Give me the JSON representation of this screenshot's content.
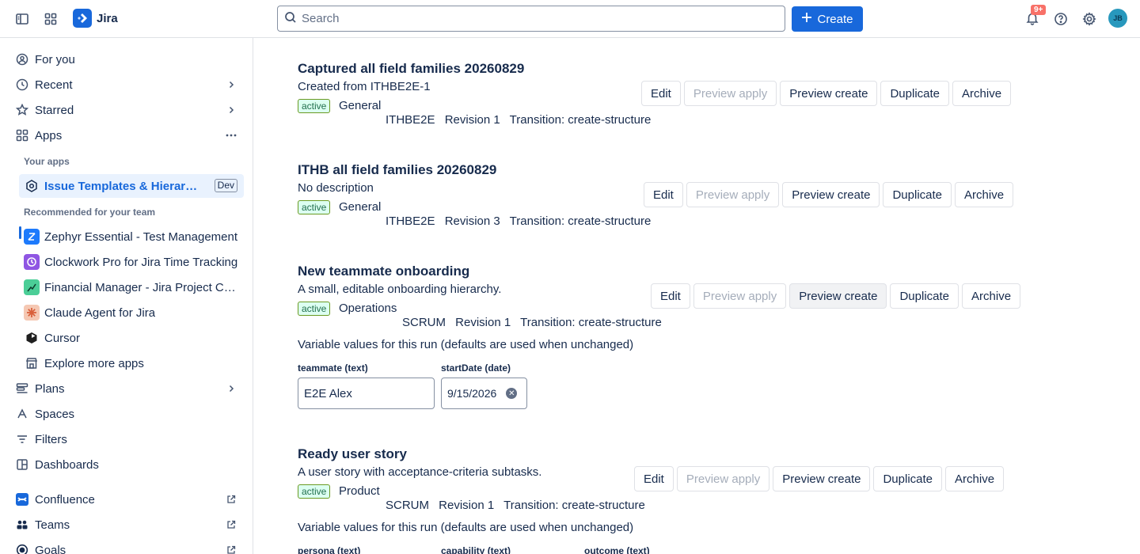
{
  "app": {
    "name": "Jira"
  },
  "topbar": {
    "search_placeholder": "Search",
    "create_label": "Create",
    "notification_count": "9+",
    "avatar_initials": "JB"
  },
  "sidebar": {
    "nav": [
      {
        "label": "For you",
        "icon": "person-circle-icon"
      },
      {
        "label": "Recent",
        "icon": "clock-icon"
      },
      {
        "label": "Starred",
        "icon": "star-icon"
      },
      {
        "label": "Apps",
        "icon": "apps-grid-icon"
      }
    ],
    "your_apps_heading": "Your apps",
    "selected_app": {
      "label": "Issue Templates & Hierarchies",
      "tag": "Dev"
    },
    "recommended_heading": "Recommended for your team",
    "recommended": [
      {
        "label": "Zephyr Essential - Test Management",
        "color": "#1d7afc"
      },
      {
        "label": "Clockwork Pro for Jira Time Tracking",
        "color": "#8f56e3"
      },
      {
        "label": "Financial Manager - Jira Project Cost",
        "color": "#4bce97"
      },
      {
        "label": "Claude Agent for Jira",
        "color": "#e8855e"
      },
      {
        "label": "Cursor",
        "color": "#1f1f1f"
      },
      {
        "label": "Explore more apps",
        "color": "#44546f"
      }
    ],
    "nav2": [
      {
        "label": "Plans",
        "icon": "plans-icon"
      },
      {
        "label": "Spaces",
        "icon": "spaces-icon"
      },
      {
        "label": "Filters",
        "icon": "filter-icon"
      },
      {
        "label": "Dashboards",
        "icon": "dashboard-icon"
      }
    ],
    "external": [
      {
        "label": "Confluence",
        "icon": "confluence-icon"
      },
      {
        "label": "Teams",
        "icon": "teams-icon"
      },
      {
        "label": "Goals",
        "icon": "goals-icon"
      }
    ]
  },
  "buttons": {
    "edit": "Edit",
    "preview_apply": "Preview apply",
    "preview_create": "Preview create",
    "duplicate": "Duplicate",
    "archive": "Archive"
  },
  "templates": [
    {
      "title": "Captured all field families 20260829",
      "description": "Created from ITHBE2E-1",
      "status": "active",
      "category": "General",
      "project": "ITHBE2E",
      "revision": "Revision 1",
      "transition": "Transition: create-structure"
    },
    {
      "title": "ITHB all field families 20260829",
      "description": "No description",
      "status": "active",
      "category": "General",
      "project": "ITHBE2E",
      "revision": "Revision 3",
      "transition": "Transition: create-structure"
    },
    {
      "title": "New teammate onboarding",
      "description": "A small, editable onboarding hierarchy.",
      "status": "active",
      "category": "Operations",
      "project": "SCRUM",
      "revision": "Revision 1",
      "transition": "Transition: create-structure",
      "variables_title": "Variable values for this run (defaults are used when unchanged)",
      "variables": [
        {
          "label": "teammate (text)",
          "value": "E2E Alex"
        },
        {
          "label": "startDate (date)",
          "value": "9/15/2026"
        }
      ]
    },
    {
      "title": "Ready user story",
      "description": "A user story with acceptance-criteria subtasks.",
      "status": "active",
      "category": "Product",
      "project": "SCRUM",
      "revision": "Revision 1",
      "transition": "Transition: create-structure",
      "variables_title": "Variable values for this run (defaults are used when unchanged)",
      "variables": [
        {
          "label": "persona (text)"
        },
        {
          "label": "capability (text)"
        },
        {
          "label": "outcome (text)"
        }
      ]
    }
  ]
}
